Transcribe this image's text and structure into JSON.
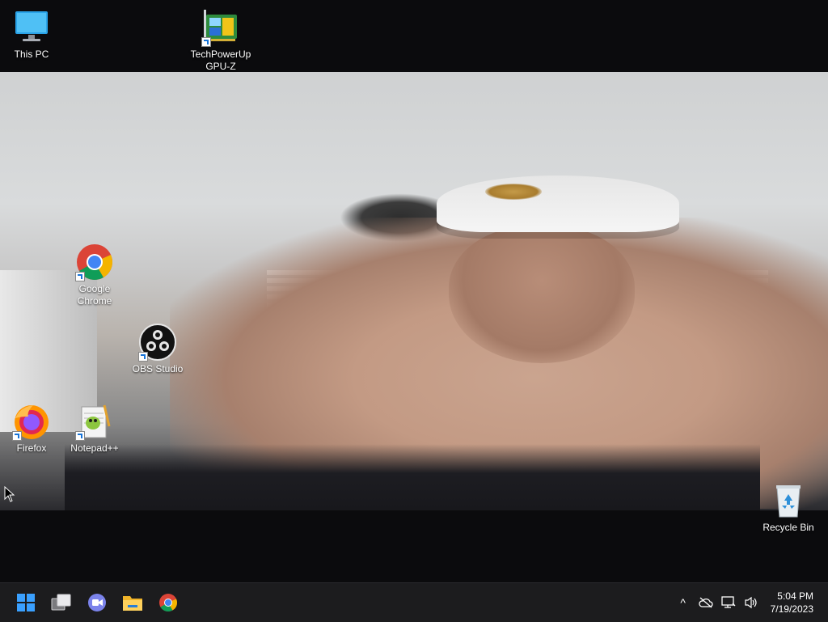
{
  "desktop": {
    "icons": [
      {
        "label": "This PC",
        "icon": "this-pc-icon"
      },
      {
        "label_line1": "TechPowerUp",
        "label_line2": "GPU-Z",
        "icon": "gpu-z-icon"
      },
      {
        "label_line1": "Google",
        "label_line2": "Chrome",
        "icon": "chrome-icon"
      },
      {
        "label": "OBS Studio",
        "icon": "obs-icon"
      },
      {
        "label": "Firefox",
        "icon": "firefox-icon"
      },
      {
        "label": "Notepad++",
        "icon": "notepadpp-icon"
      },
      {
        "label": "Recycle Bin",
        "icon": "recycle-bin-icon"
      }
    ]
  },
  "taskbar": {
    "apps": [
      "start-icon",
      "task-view-icon",
      "teams-chat-icon",
      "file-explorer-icon",
      "chrome-icon"
    ],
    "tray": {
      "chevron": "^",
      "time": "5:04 PM",
      "date": "7/19/2023"
    }
  },
  "colors": {
    "taskbar_bg": "#1c1c1e",
    "desktop_bg": "#0b0b0d",
    "windows_blue": "#1a8fff"
  }
}
